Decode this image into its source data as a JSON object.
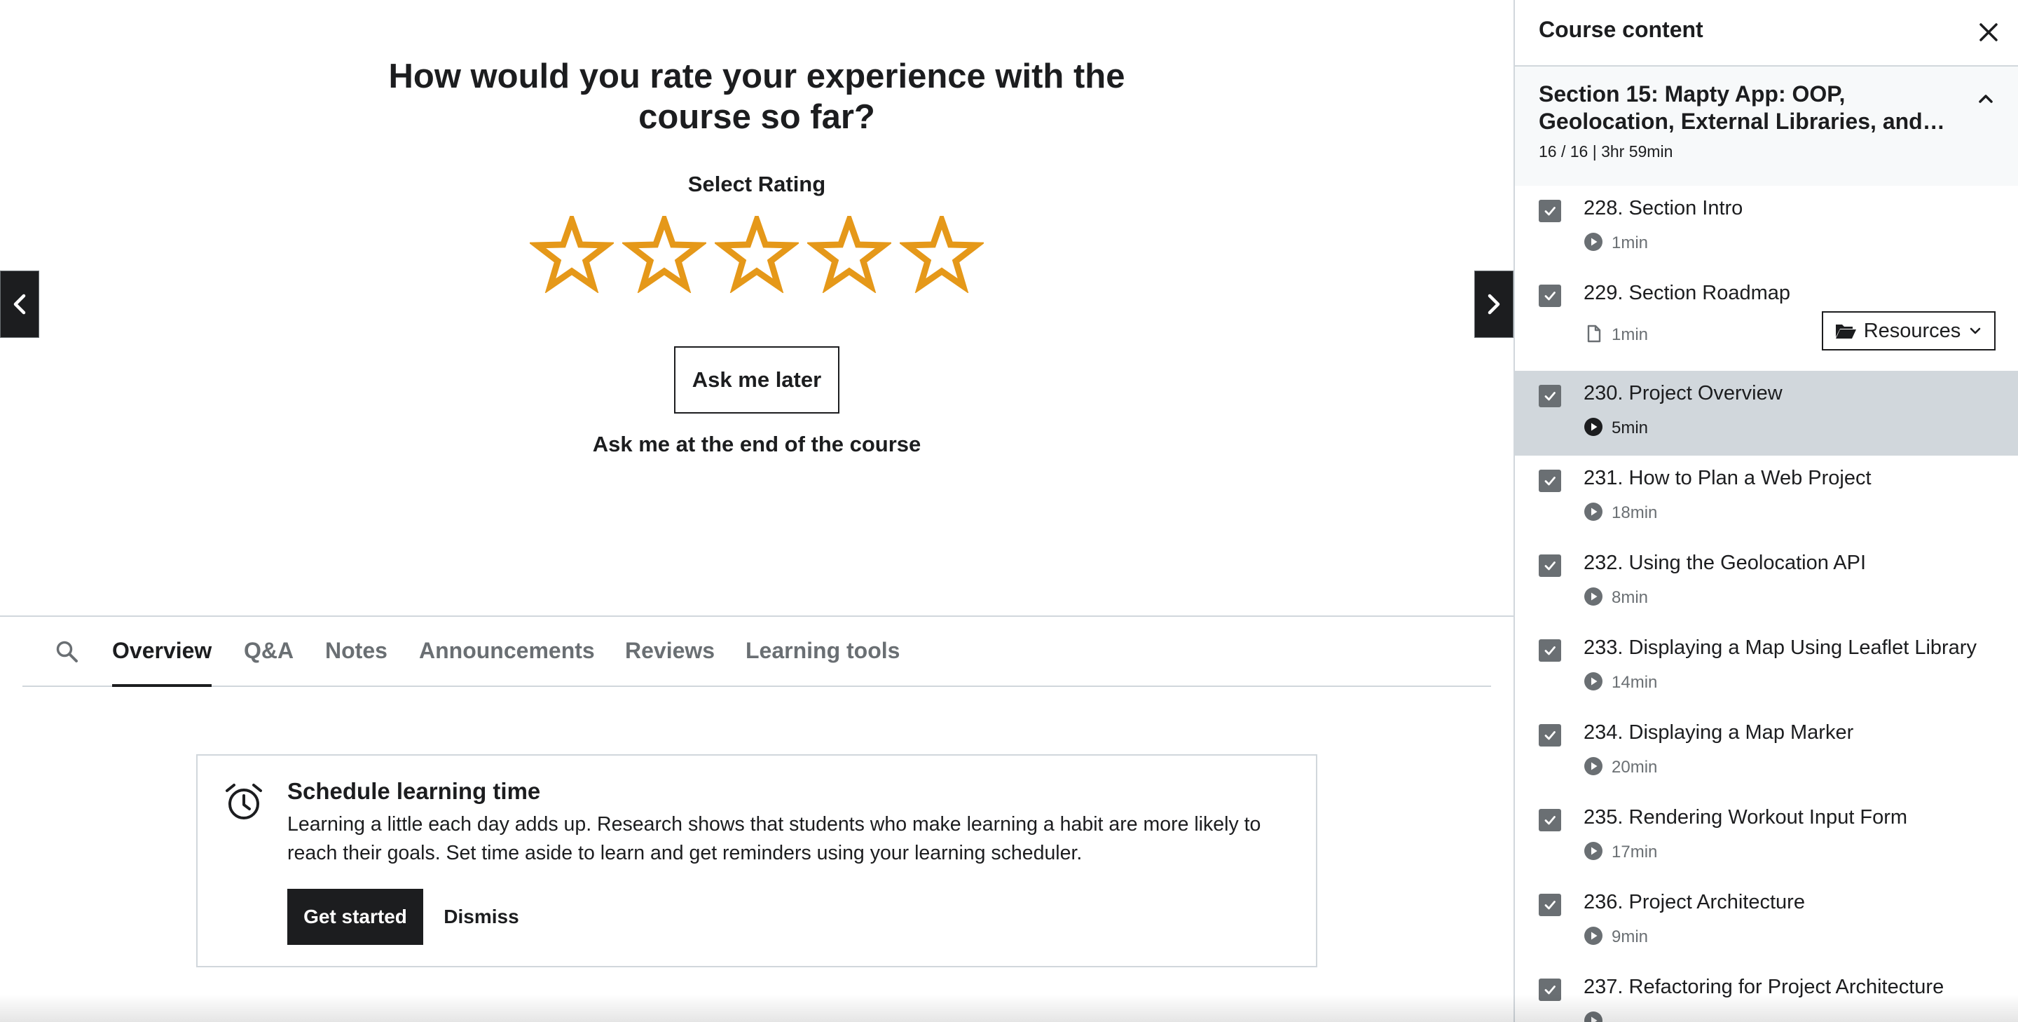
{
  "rating_prompt": {
    "title": "How would you rate your experience with the course so far?",
    "select_label": "Select Rating",
    "stars": 5,
    "selected": 0,
    "star_color": "#e59819",
    "ask_later": "Ask me later",
    "ask_end": "Ask me at the end of the course"
  },
  "tabs": [
    {
      "label": "Overview",
      "active": true
    },
    {
      "label": "Q&A",
      "active": false
    },
    {
      "label": "Notes",
      "active": false
    },
    {
      "label": "Announcements",
      "active": false
    },
    {
      "label": "Reviews",
      "active": false
    },
    {
      "label": "Learning tools",
      "active": false
    }
  ],
  "schedule": {
    "title": "Schedule learning time",
    "body": "Learning a little each day adds up. Research shows that students who make learning a habit are more likely to reach their goals. Set time aside to learn and get reminders using your learning scheduler.",
    "get_started": "Get started",
    "dismiss": "Dismiss"
  },
  "sidebar": {
    "title": "Course content",
    "section": {
      "title": "Section 15: Mapty App: OOP, Geolocation, External Libraries, and…",
      "meta": "16 / 16 | 3hr 59min"
    },
    "resources_label": "Resources",
    "lectures": [
      {
        "title": "228. Section Intro",
        "duration": "1min",
        "type": "video",
        "done": true,
        "current": false
      },
      {
        "title": "229. Section Roadmap",
        "duration": "1min",
        "type": "article",
        "done": true,
        "current": false,
        "resources": true
      },
      {
        "title": "230. Project Overview",
        "duration": "5min",
        "type": "video",
        "done": true,
        "current": true
      },
      {
        "title": "231. How to Plan a Web Project",
        "duration": "18min",
        "type": "video",
        "done": true,
        "current": false
      },
      {
        "title": "232. Using the Geolocation API",
        "duration": "8min",
        "type": "video",
        "done": true,
        "current": false
      },
      {
        "title": "233. Displaying a Map Using Leaflet Library",
        "duration": "14min",
        "type": "video",
        "done": true,
        "current": false
      },
      {
        "title": "234. Displaying a Map Marker",
        "duration": "20min",
        "type": "video",
        "done": true,
        "current": false
      },
      {
        "title": "235. Rendering Workout Input Form",
        "duration": "17min",
        "type": "video",
        "done": true,
        "current": false
      },
      {
        "title": "236. Project Architecture",
        "duration": "9min",
        "type": "video",
        "done": true,
        "current": false
      },
      {
        "title": "237. Refactoring for Project Architecture",
        "duration": "",
        "type": "video",
        "done": true,
        "current": false
      }
    ]
  }
}
